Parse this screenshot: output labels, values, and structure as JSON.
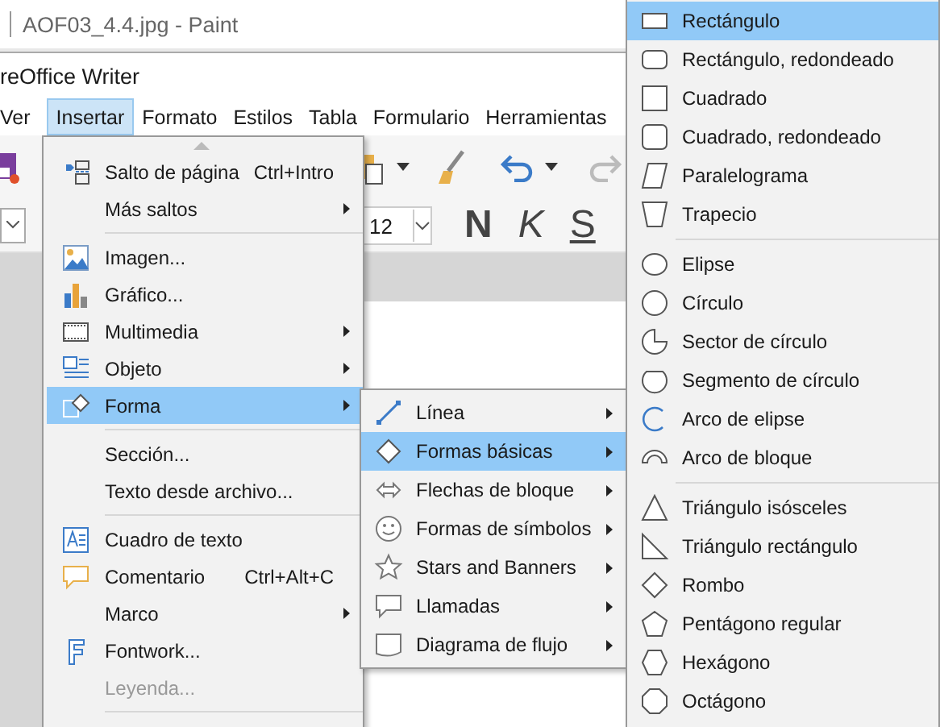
{
  "paint_window": {
    "title": "AOF03_4.4.jpg - Paint"
  },
  "writer_window": {
    "title": "reOffice Writer",
    "menu_bar": [
      {
        "label": "Ver",
        "selected": false
      },
      {
        "label": "Insertar",
        "selected": true
      },
      {
        "label": "Formato",
        "selected": false
      },
      {
        "label": "Estilos",
        "selected": false
      },
      {
        "label": "Tabla",
        "selected": false
      },
      {
        "label": "Formulario",
        "selected": false
      },
      {
        "label": "Herramientas",
        "selected": false
      }
    ],
    "font_size": "12",
    "format_buttons": [
      "N",
      "K",
      "S"
    ]
  },
  "insert_menu": [
    {
      "kind": "item",
      "label": "Salto de página",
      "shortcut": "Ctrl+Intro",
      "submenu": false,
      "selected": false,
      "disabled": false
    },
    {
      "kind": "item",
      "label": "Más saltos",
      "submenu": true,
      "selected": false,
      "disabled": false
    },
    {
      "kind": "separator"
    },
    {
      "kind": "item",
      "label": "Imagen...",
      "submenu": false,
      "selected": false,
      "disabled": false
    },
    {
      "kind": "item",
      "label": "Gráfico...",
      "submenu": false,
      "selected": false,
      "disabled": false
    },
    {
      "kind": "item",
      "label": "Multimedia",
      "submenu": true,
      "selected": false,
      "disabled": false
    },
    {
      "kind": "item",
      "label": "Objeto",
      "submenu": true,
      "selected": false,
      "disabled": false
    },
    {
      "kind": "item",
      "label": "Forma",
      "submenu": true,
      "selected": true,
      "disabled": false
    },
    {
      "kind": "separator"
    },
    {
      "kind": "item",
      "label": "Sección...",
      "submenu": false,
      "selected": false,
      "disabled": false
    },
    {
      "kind": "item",
      "label": "Texto desde archivo...",
      "submenu": false,
      "selected": false,
      "disabled": false
    },
    {
      "kind": "separator"
    },
    {
      "kind": "item",
      "label": "Cuadro de texto",
      "submenu": false,
      "selected": false,
      "disabled": false
    },
    {
      "kind": "item",
      "label": "Comentario",
      "shortcut": "Ctrl+Alt+C",
      "submenu": false,
      "selected": false,
      "disabled": false
    },
    {
      "kind": "item",
      "label": "Marco",
      "submenu": true,
      "selected": false,
      "disabled": false
    },
    {
      "kind": "item",
      "label": "Fontwork...",
      "submenu": false,
      "selected": false,
      "disabled": false
    },
    {
      "kind": "item",
      "label": "Leyenda...",
      "submenu": false,
      "selected": false,
      "disabled": true
    },
    {
      "kind": "separator"
    }
  ],
  "shape_menu": [
    {
      "kind": "item",
      "label": "Línea",
      "submenu": true,
      "selected": false
    },
    {
      "kind": "item",
      "label": "Formas básicas",
      "submenu": true,
      "selected": true
    },
    {
      "kind": "item",
      "label": "Flechas de bloque",
      "submenu": true,
      "selected": false
    },
    {
      "kind": "item",
      "label": "Formas de símbolos",
      "submenu": true,
      "selected": false
    },
    {
      "kind": "item",
      "label": "Stars and Banners",
      "submenu": true,
      "selected": false
    },
    {
      "kind": "item",
      "label": "Llamadas",
      "submenu": true,
      "selected": false
    },
    {
      "kind": "item",
      "label": "Diagrama de flujo",
      "submenu": true,
      "selected": false
    }
  ],
  "basic_shapes_menu": [
    {
      "kind": "item",
      "label": "Rectángulo",
      "selected": true
    },
    {
      "kind": "item",
      "label": "Rectángulo, redondeado",
      "selected": false
    },
    {
      "kind": "item",
      "label": "Cuadrado",
      "selected": false
    },
    {
      "kind": "item",
      "label": "Cuadrado, redondeado",
      "selected": false
    },
    {
      "kind": "item",
      "label": "Paralelograma",
      "selected": false
    },
    {
      "kind": "item",
      "label": "Trapecio",
      "selected": false
    },
    {
      "kind": "separator"
    },
    {
      "kind": "item",
      "label": "Elipse",
      "selected": false
    },
    {
      "kind": "item",
      "label": "Círculo",
      "selected": false
    },
    {
      "kind": "item",
      "label": "Sector de círculo",
      "selected": false
    },
    {
      "kind": "item",
      "label": "Segmento de círculo",
      "selected": false
    },
    {
      "kind": "item",
      "label": "Arco de elipse",
      "selected": false
    },
    {
      "kind": "item",
      "label": "Arco de bloque",
      "selected": false
    },
    {
      "kind": "separator"
    },
    {
      "kind": "item",
      "label": "Triángulo isósceles",
      "selected": false
    },
    {
      "kind": "item",
      "label": "Triángulo rectángulo",
      "selected": false
    },
    {
      "kind": "item",
      "label": "Rombo",
      "selected": false
    },
    {
      "kind": "item",
      "label": "Pentágono regular",
      "selected": false
    },
    {
      "kind": "item",
      "label": "Hexágono",
      "selected": false
    },
    {
      "kind": "item",
      "label": "Octágono",
      "selected": false
    }
  ]
}
